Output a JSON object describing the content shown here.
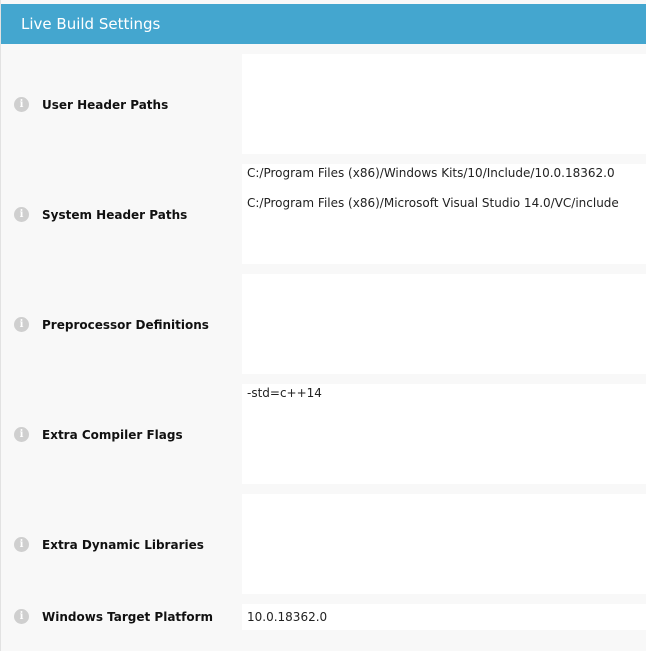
{
  "panel": {
    "title": "Live Build Settings"
  },
  "settings": [
    {
      "label": "User Header Paths",
      "values": []
    },
    {
      "label": "System Header Paths",
      "values": [
        "C:/Program Files (x86)/Windows Kits/10/Include/10.0.18362.0",
        "C:/Program Files (x86)/Microsoft Visual Studio 14.0/VC/include"
      ]
    },
    {
      "label": "Preprocessor Definitions",
      "values": []
    },
    {
      "label": "Extra Compiler Flags",
      "values": [
        "-std=c++14"
      ]
    },
    {
      "label": "Extra Dynamic Libraries",
      "values": []
    },
    {
      "label": "Windows Target Platform",
      "values": [
        "10.0.18362.0"
      ]
    }
  ],
  "icons": {
    "info": "info-icon",
    "info_glyph": "i"
  },
  "colors": {
    "title_bar": "#44a6cf",
    "panel_bg": "#f8f8f8",
    "field_bg": "#ffffff"
  }
}
